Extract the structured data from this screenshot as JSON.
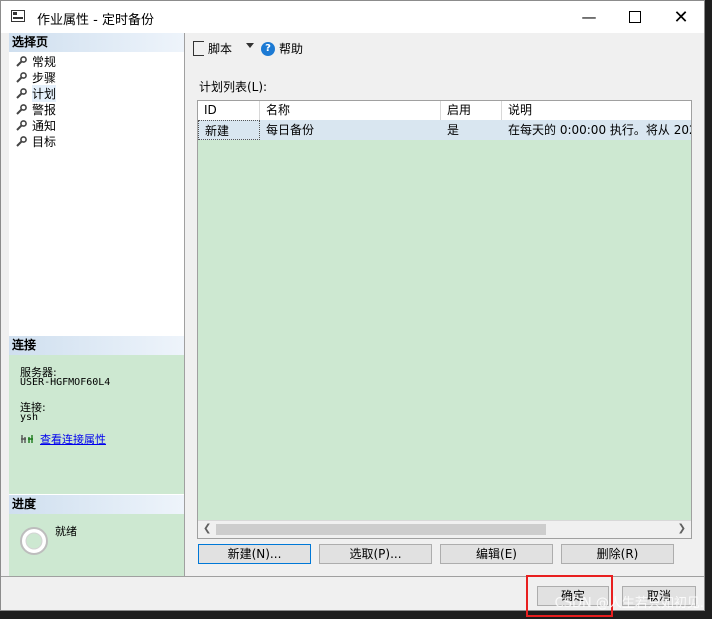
{
  "window": {
    "title": "作业属性 - 定时备份"
  },
  "left": {
    "select_page": {
      "header": "选择页",
      "items": [
        "常规",
        "步骤",
        "计划",
        "警报",
        "通知",
        "目标"
      ]
    },
    "connection": {
      "header": "连接",
      "server_label": "服务器:",
      "server_value": "USER-HGFMOF60L4",
      "conn_label": "连接:",
      "conn_value": "ysh",
      "view_link": "查看连接属性"
    },
    "progress": {
      "header": "进度",
      "status": "就绪"
    }
  },
  "toolbar": {
    "script": "脚本",
    "help": "帮助"
  },
  "schedule": {
    "list_label": "计划列表(L):",
    "columns": [
      "ID",
      "名称",
      "启用",
      "说明"
    ],
    "rows": [
      {
        "id": "新建",
        "name": "每日备份",
        "enabled": "是",
        "desc": "在每天的 0:00:00 执行。将从 202"
      }
    ]
  },
  "buttons": {
    "new": "新建(N)...",
    "pick": "选取(P)...",
    "edit": "编辑(E)",
    "delete": "删除(R)",
    "ok": "确定",
    "cancel": "取消"
  },
  "watermark": "CSDN @人生若只如初见."
}
